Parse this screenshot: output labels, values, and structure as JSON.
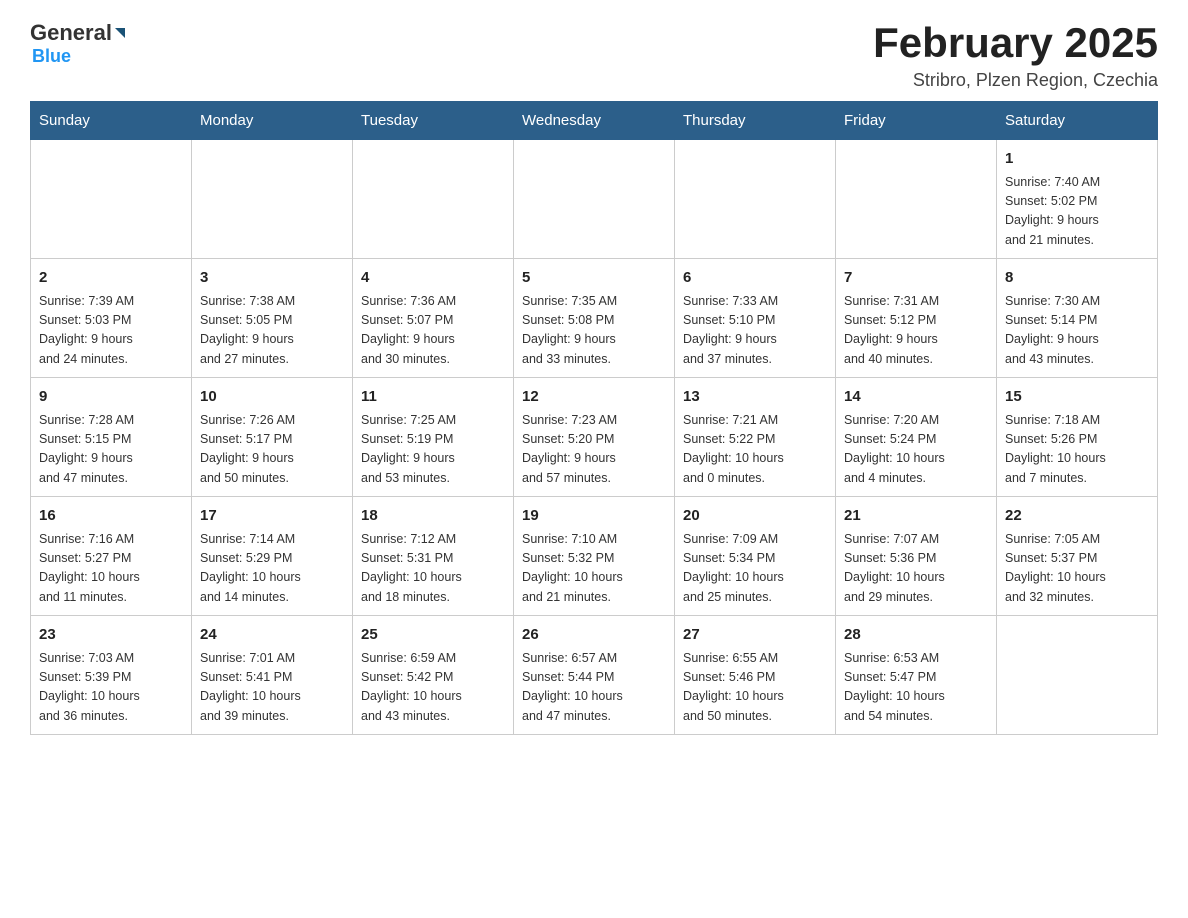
{
  "header": {
    "logo_text1": "General",
    "logo_text2": "Blue",
    "month_title": "February 2025",
    "location": "Stribro, Plzen Region, Czechia"
  },
  "days_of_week": [
    "Sunday",
    "Monday",
    "Tuesday",
    "Wednesday",
    "Thursday",
    "Friday",
    "Saturday"
  ],
  "weeks": [
    {
      "days": [
        {
          "num": "",
          "info": ""
        },
        {
          "num": "",
          "info": ""
        },
        {
          "num": "",
          "info": ""
        },
        {
          "num": "",
          "info": ""
        },
        {
          "num": "",
          "info": ""
        },
        {
          "num": "",
          "info": ""
        },
        {
          "num": "1",
          "info": "Sunrise: 7:40 AM\nSunset: 5:02 PM\nDaylight: 9 hours\nand 21 minutes."
        }
      ]
    },
    {
      "days": [
        {
          "num": "2",
          "info": "Sunrise: 7:39 AM\nSunset: 5:03 PM\nDaylight: 9 hours\nand 24 minutes."
        },
        {
          "num": "3",
          "info": "Sunrise: 7:38 AM\nSunset: 5:05 PM\nDaylight: 9 hours\nand 27 minutes."
        },
        {
          "num": "4",
          "info": "Sunrise: 7:36 AM\nSunset: 5:07 PM\nDaylight: 9 hours\nand 30 minutes."
        },
        {
          "num": "5",
          "info": "Sunrise: 7:35 AM\nSunset: 5:08 PM\nDaylight: 9 hours\nand 33 minutes."
        },
        {
          "num": "6",
          "info": "Sunrise: 7:33 AM\nSunset: 5:10 PM\nDaylight: 9 hours\nand 37 minutes."
        },
        {
          "num": "7",
          "info": "Sunrise: 7:31 AM\nSunset: 5:12 PM\nDaylight: 9 hours\nand 40 minutes."
        },
        {
          "num": "8",
          "info": "Sunrise: 7:30 AM\nSunset: 5:14 PM\nDaylight: 9 hours\nand 43 minutes."
        }
      ]
    },
    {
      "days": [
        {
          "num": "9",
          "info": "Sunrise: 7:28 AM\nSunset: 5:15 PM\nDaylight: 9 hours\nand 47 minutes."
        },
        {
          "num": "10",
          "info": "Sunrise: 7:26 AM\nSunset: 5:17 PM\nDaylight: 9 hours\nand 50 minutes."
        },
        {
          "num": "11",
          "info": "Sunrise: 7:25 AM\nSunset: 5:19 PM\nDaylight: 9 hours\nand 53 minutes."
        },
        {
          "num": "12",
          "info": "Sunrise: 7:23 AM\nSunset: 5:20 PM\nDaylight: 9 hours\nand 57 minutes."
        },
        {
          "num": "13",
          "info": "Sunrise: 7:21 AM\nSunset: 5:22 PM\nDaylight: 10 hours\nand 0 minutes."
        },
        {
          "num": "14",
          "info": "Sunrise: 7:20 AM\nSunset: 5:24 PM\nDaylight: 10 hours\nand 4 minutes."
        },
        {
          "num": "15",
          "info": "Sunrise: 7:18 AM\nSunset: 5:26 PM\nDaylight: 10 hours\nand 7 minutes."
        }
      ]
    },
    {
      "days": [
        {
          "num": "16",
          "info": "Sunrise: 7:16 AM\nSunset: 5:27 PM\nDaylight: 10 hours\nand 11 minutes."
        },
        {
          "num": "17",
          "info": "Sunrise: 7:14 AM\nSunset: 5:29 PM\nDaylight: 10 hours\nand 14 minutes."
        },
        {
          "num": "18",
          "info": "Sunrise: 7:12 AM\nSunset: 5:31 PM\nDaylight: 10 hours\nand 18 minutes."
        },
        {
          "num": "19",
          "info": "Sunrise: 7:10 AM\nSunset: 5:32 PM\nDaylight: 10 hours\nand 21 minutes."
        },
        {
          "num": "20",
          "info": "Sunrise: 7:09 AM\nSunset: 5:34 PM\nDaylight: 10 hours\nand 25 minutes."
        },
        {
          "num": "21",
          "info": "Sunrise: 7:07 AM\nSunset: 5:36 PM\nDaylight: 10 hours\nand 29 minutes."
        },
        {
          "num": "22",
          "info": "Sunrise: 7:05 AM\nSunset: 5:37 PM\nDaylight: 10 hours\nand 32 minutes."
        }
      ]
    },
    {
      "days": [
        {
          "num": "23",
          "info": "Sunrise: 7:03 AM\nSunset: 5:39 PM\nDaylight: 10 hours\nand 36 minutes."
        },
        {
          "num": "24",
          "info": "Sunrise: 7:01 AM\nSunset: 5:41 PM\nDaylight: 10 hours\nand 39 minutes."
        },
        {
          "num": "25",
          "info": "Sunrise: 6:59 AM\nSunset: 5:42 PM\nDaylight: 10 hours\nand 43 minutes."
        },
        {
          "num": "26",
          "info": "Sunrise: 6:57 AM\nSunset: 5:44 PM\nDaylight: 10 hours\nand 47 minutes."
        },
        {
          "num": "27",
          "info": "Sunrise: 6:55 AM\nSunset: 5:46 PM\nDaylight: 10 hours\nand 50 minutes."
        },
        {
          "num": "28",
          "info": "Sunrise: 6:53 AM\nSunset: 5:47 PM\nDaylight: 10 hours\nand 54 minutes."
        },
        {
          "num": "",
          "info": ""
        }
      ]
    }
  ]
}
